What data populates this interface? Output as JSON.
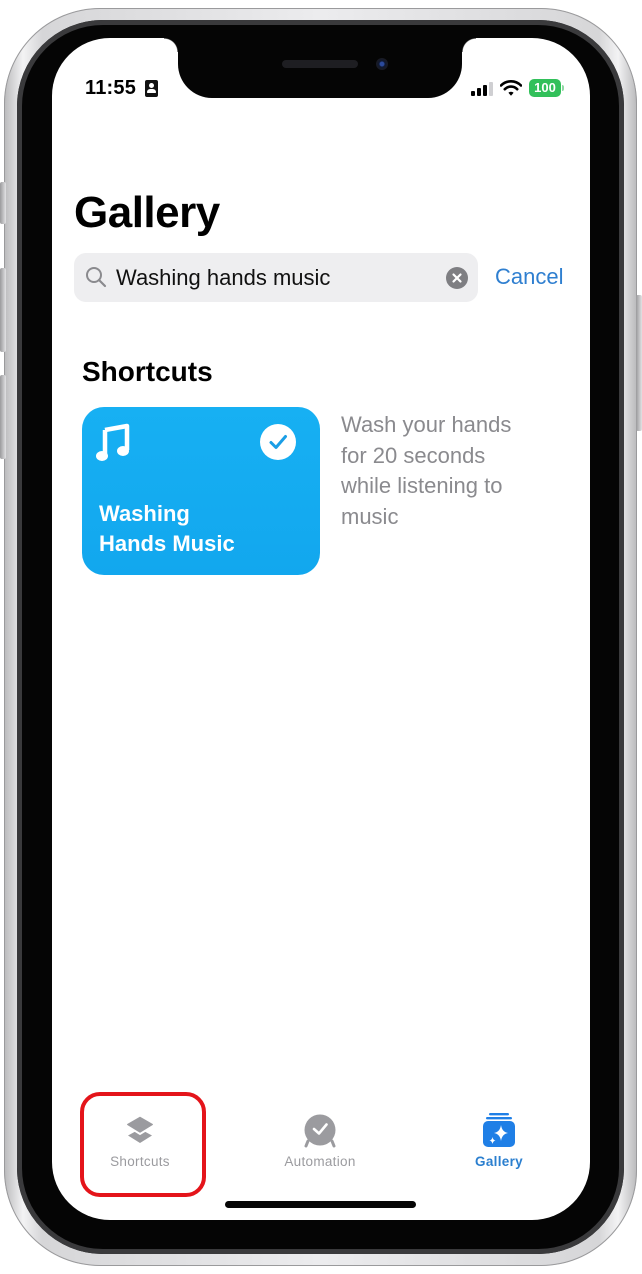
{
  "status_bar": {
    "time": "11:55",
    "status_icon": "contact-card-icon",
    "signal_icon": "cellular-signal-icon",
    "wifi_icon": "wifi-icon",
    "battery_level": "100",
    "battery_color": "#32c05a"
  },
  "header": {
    "title": "Gallery"
  },
  "search": {
    "value": "Washing hands music",
    "placeholder": "Search",
    "clear_icon": "clear-circle-icon",
    "cancel_label": "Cancel"
  },
  "results": {
    "section_title": "Shortcuts",
    "items": [
      {
        "title_line1": "Washing",
        "title_line2": "Hands Music",
        "icon": "music-note-icon",
        "status_icon": "checkmark-circle-icon",
        "description": "Wash your hands for 20 seconds while listening to music",
        "description_lines": [
          "Wash your hands",
          "for 20 seconds",
          "while listening to",
          "music"
        ],
        "color": "#16adf2"
      }
    ]
  },
  "tab_bar": {
    "tabs": [
      {
        "label": "Shortcuts",
        "icon": "layers-icon",
        "active": false,
        "highlighted": true
      },
      {
        "label": "Automation",
        "icon": "automation-clock-icon",
        "active": false,
        "highlighted": false
      },
      {
        "label": "Gallery",
        "icon": "gallery-sparkle-icon",
        "active": true,
        "highlighted": false
      }
    ],
    "active_color": "#2b7fcf",
    "inactive_color": "#9b9b9f"
  },
  "annotation": {
    "highlight_color": "#e4141a",
    "target": "Shortcuts"
  }
}
